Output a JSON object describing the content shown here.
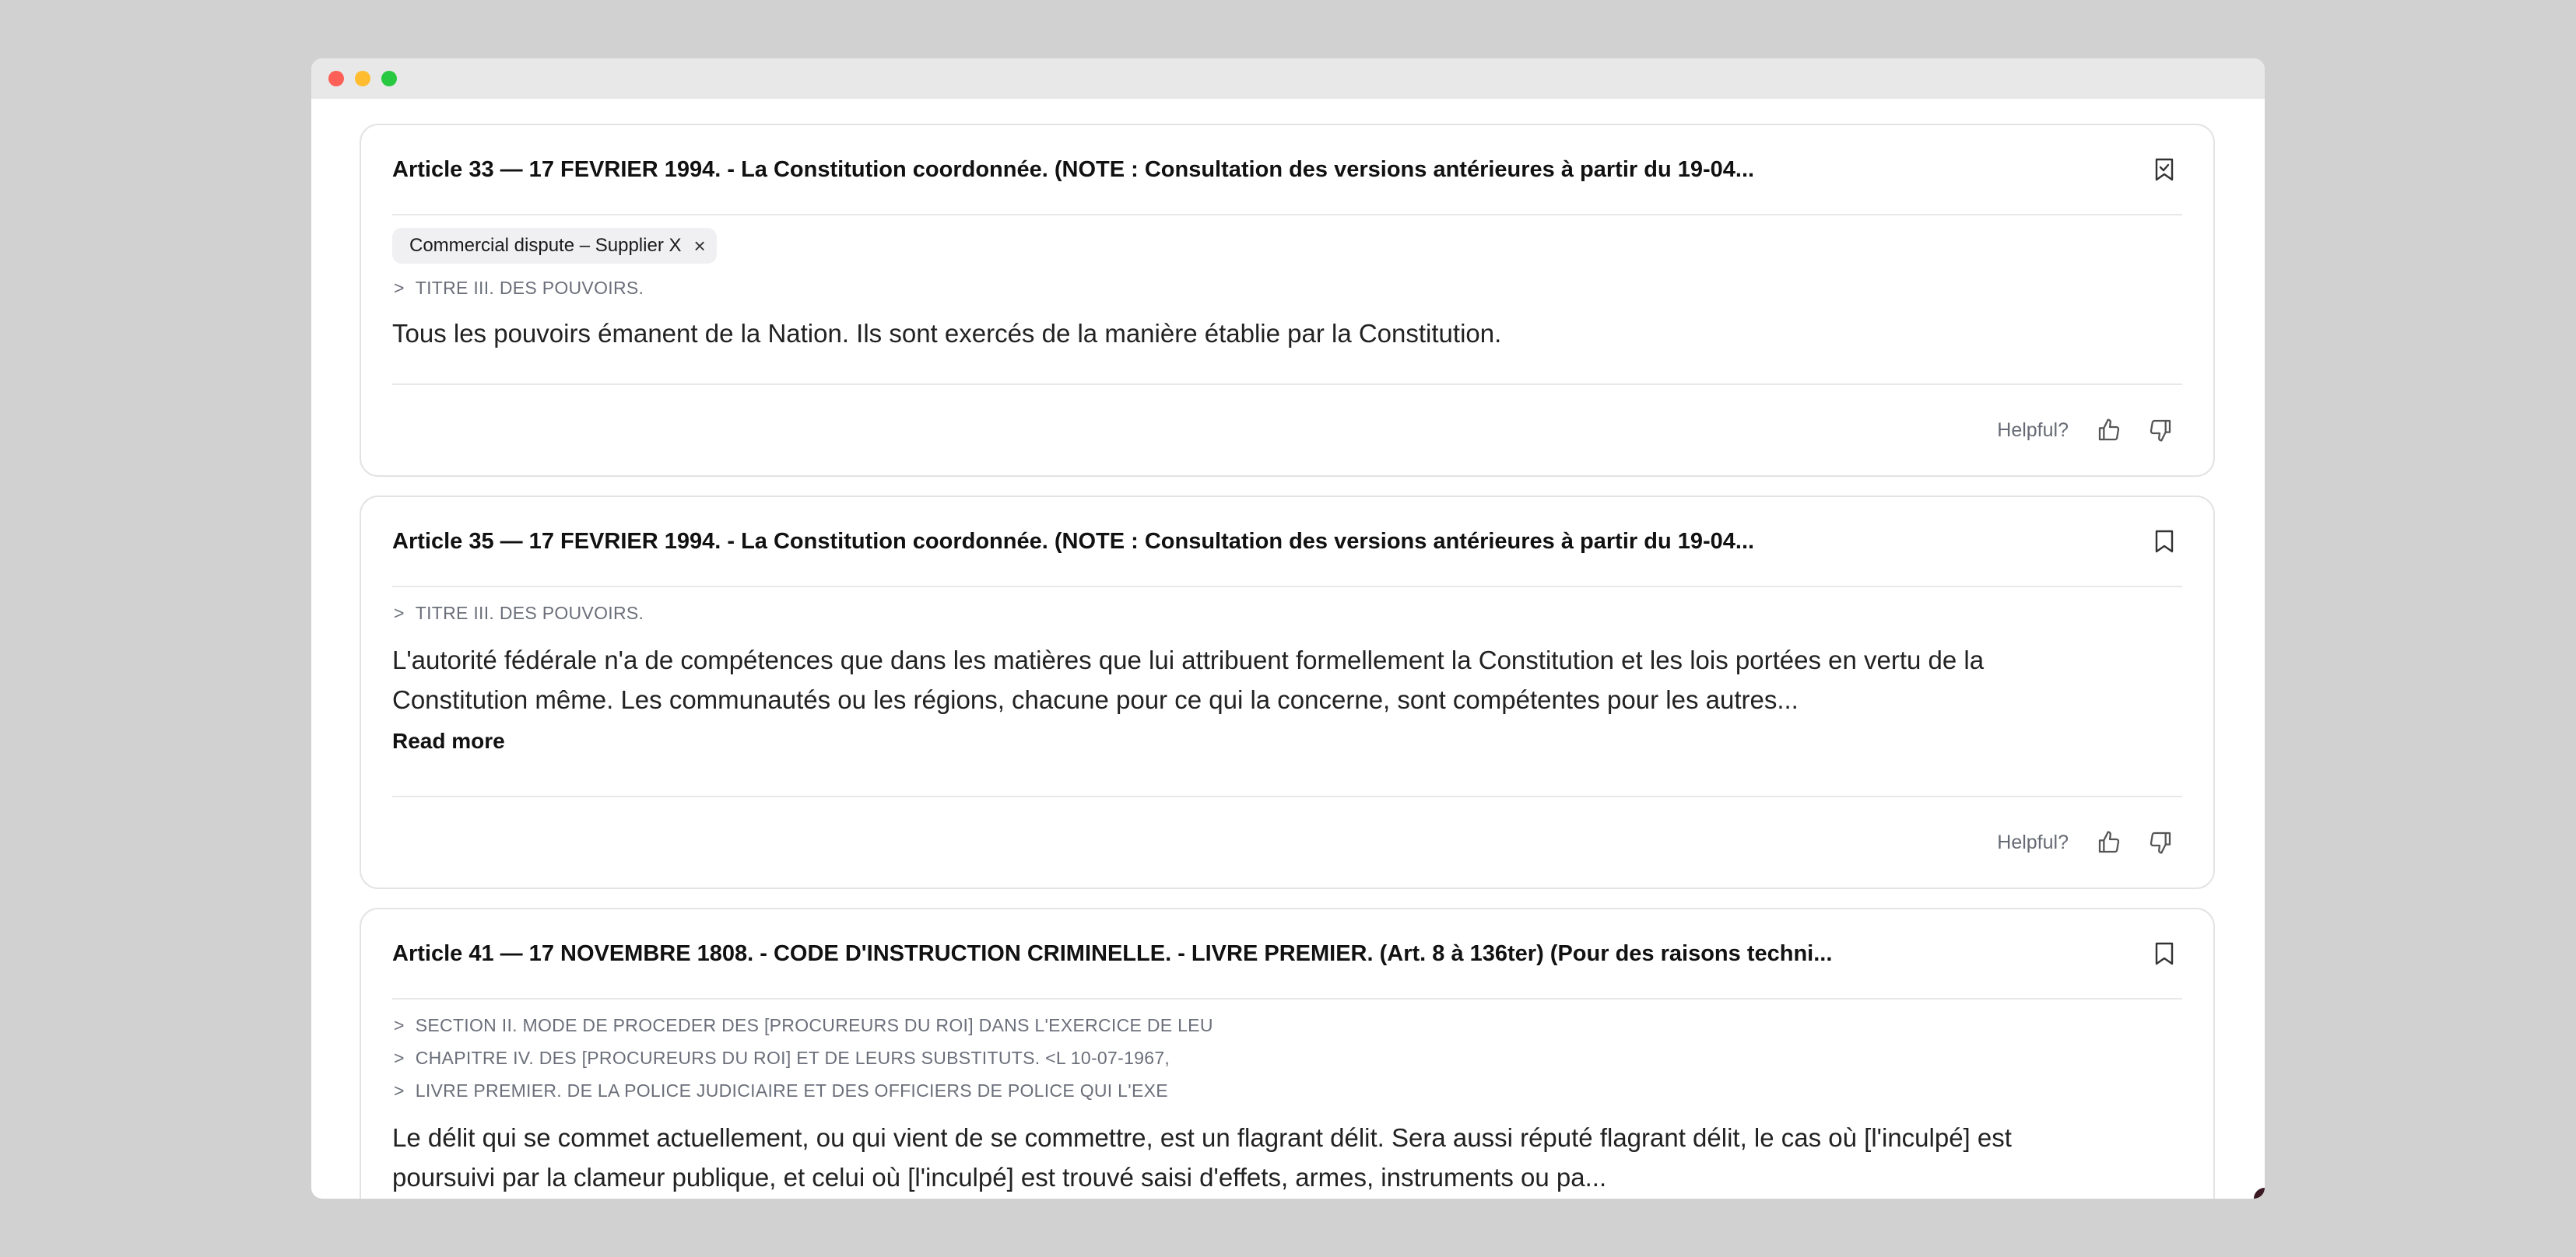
{
  "window": {
    "controls": [
      "close",
      "minimize",
      "maximize"
    ]
  },
  "cards": [
    {
      "title": "Article 33 — 17 FEVRIER 1994. - La Constitution coordonnée. (NOTE : Consultation des versions antérieures à partir du 19-04...",
      "bookmark_icon": "bookmark-check-icon",
      "bookmarked": true,
      "tag": "Commercial dispute – Supplier X",
      "crumbs": [
        "TITRE III. DES POUVOIRS."
      ],
      "text_lines": [
        "Tous les pouvoirs émanent de la Nation. Ils sont exercés de la manière établie par la Constitution."
      ],
      "helpful_label": "Helpful?"
    },
    {
      "title": "Article 35 — 17 FEVRIER 1994. - La Constitution coordonnée. (NOTE : Consultation des versions antérieures à partir du 19-04...",
      "bookmark_icon": "bookmark-icon",
      "bookmarked": false,
      "crumbs": [
        "TITRE III. DES POUVOIRS."
      ],
      "text_lines": [
        "L'autorité fédérale n'a de compétences que dans les matières que lui attribuent formellement la Constitution et les lois portées en vertu de la",
        "Constitution même. Les communautés ou les régions, chacune pour ce qui la concerne, sont compétentes pour les autres..."
      ],
      "read_more": "Read more",
      "helpful_label": "Helpful?"
    },
    {
      "title": "Article 41 — 17 NOVEMBRE 1808. - CODE D'INSTRUCTION CRIMINELLE. - LIVRE PREMIER. (Art. 8 à 136ter) (Pour des raisons techni...",
      "bookmark_icon": "bookmark-icon",
      "bookmarked": false,
      "crumbs": [
        "SECTION II. MODE DE PROCEDER DES [PROCUREURS DU ROI] DANS L'EXERCICE DE LEU",
        "CHAPITRE IV. DES [PROCUREURS DU ROI] ET DE LEURS SUBSTITUTS. <L 10-07-1967,",
        "LIVRE PREMIER. DE LA POLICE JUDICIAIRE ET DES OFFICIERS DE POLICE QUI L'EXE"
      ],
      "text_lines": [
        "Le délit qui se commet actuellement, ou qui vient de se commettre, est un flagrant délit. Sera aussi réputé flagrant délit, le cas où [l'inculpé] est",
        "poursuivi par la clameur publique, et celui où [l'inculpé] est trouvé saisi d'effets, armes, instruments ou pa..."
      ]
    }
  ],
  "crumb_marker": ">",
  "tag_remove_glyph": "×",
  "icons": {
    "thumbs_up": "thumbs-up-icon",
    "thumbs_down": "thumbs-down-icon"
  }
}
